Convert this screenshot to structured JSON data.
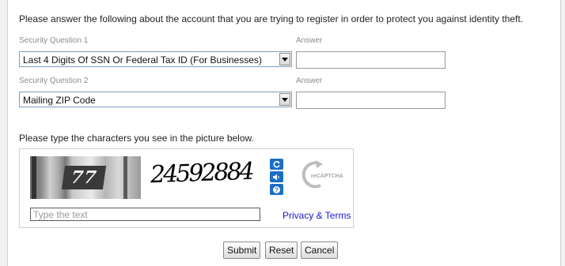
{
  "form": {
    "intro": "Please answer the following about the account that you are trying to register in order to protect you against identity theft.",
    "questions": [
      {
        "label": "Security Question 1",
        "selected": "Last 4 Digits Of SSN Or Federal Tax ID (For Businesses)",
        "answer_label": "Answer",
        "answer_value": ""
      },
      {
        "label": "Security Question 2",
        "selected": "Mailing ZIP Code",
        "answer_label": "Answer",
        "answer_value": ""
      }
    ]
  },
  "captcha": {
    "prompt": "Please type the characters you see in the picture below.",
    "photo_text": "77",
    "warped_text": "24592884",
    "placeholder": "Type the text",
    "logo_text": "reCAPTCHA",
    "privacy_link": "Privacy & Terms",
    "icons": [
      "refresh-icon",
      "audio-icon",
      "help-icon"
    ],
    "accent_color": "#1a6ec8"
  },
  "buttons": {
    "submit": "Submit",
    "reset": "Reset",
    "cancel": "Cancel"
  }
}
